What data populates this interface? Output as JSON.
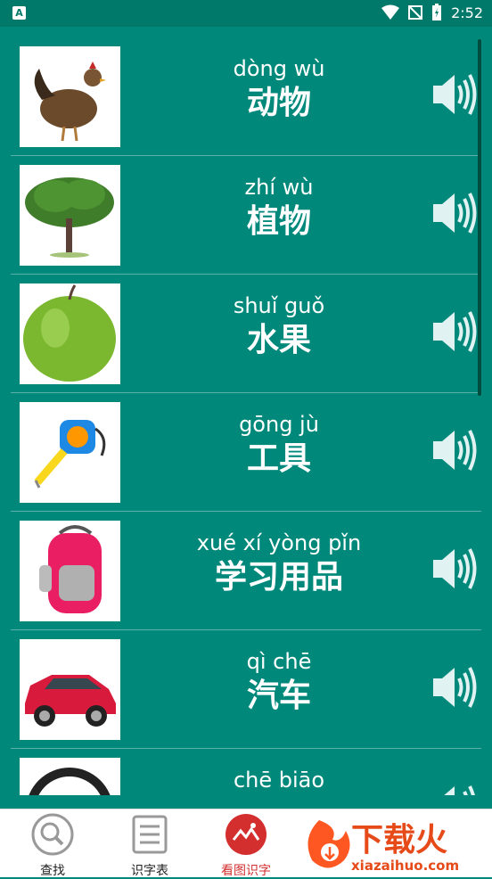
{
  "status": {
    "time": "2:52",
    "left_icon": "A"
  },
  "items": [
    {
      "pinyin": "dòng wù",
      "hanzi": "动物",
      "image": "rooster"
    },
    {
      "pinyin": "zhí wù",
      "hanzi": "植物",
      "image": "tree"
    },
    {
      "pinyin": "shuǐ guǒ",
      "hanzi": "水果",
      "image": "apple"
    },
    {
      "pinyin": "gōng jù",
      "hanzi": "工具",
      "image": "tape-measure"
    },
    {
      "pinyin": "xué xí yòng pǐn",
      "hanzi": "学习用品",
      "image": "backpack"
    },
    {
      "pinyin": "qì chē",
      "hanzi": "汽车",
      "image": "car"
    },
    {
      "pinyin": "chē biāo",
      "hanzi": "",
      "image": "steering-wheel"
    }
  ],
  "tabs": [
    {
      "label": "查找",
      "icon": "search-icon"
    },
    {
      "label": "识字表",
      "icon": "list-icon"
    },
    {
      "label": "看图识字",
      "icon": "picture-icon",
      "active": true
    }
  ],
  "watermark": {
    "brand": "下载火",
    "url": "xiazaihuo.com"
  },
  "colors": {
    "background": "#00897b",
    "accent": "#d32f2f"
  }
}
